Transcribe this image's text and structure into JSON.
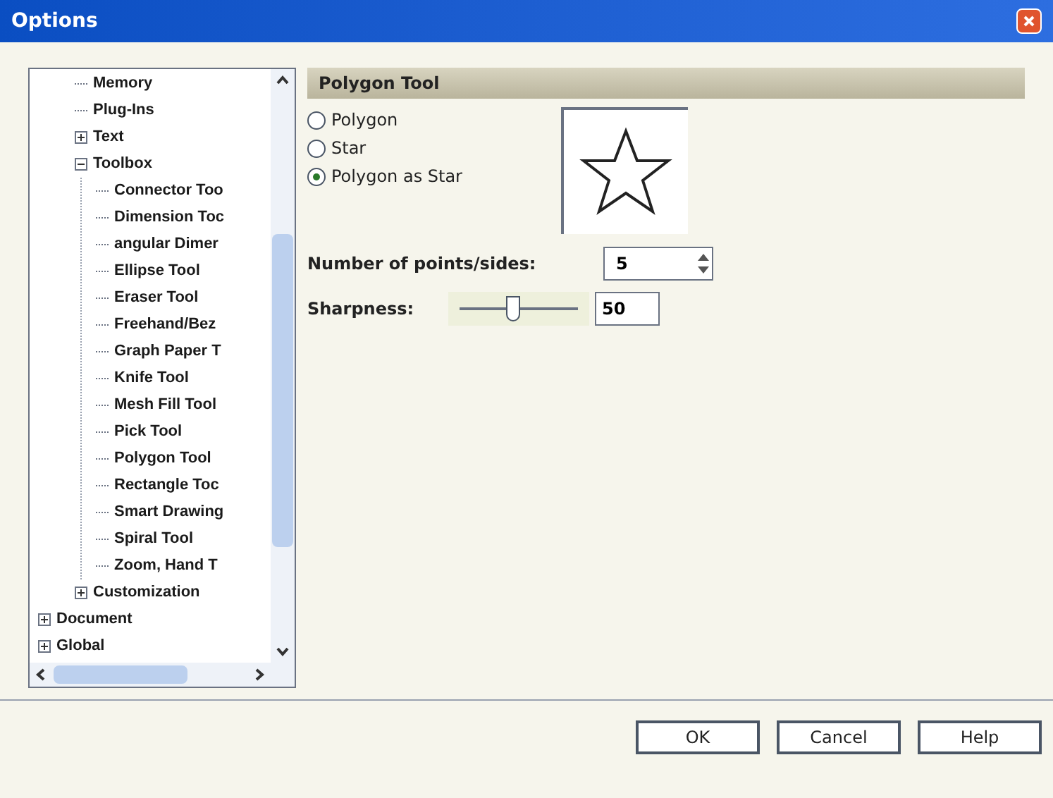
{
  "window": {
    "title": "Options"
  },
  "tree": [
    {
      "children": [
        {
          "label": "Memory"
        },
        {
          "label": "Plug-Ins"
        },
        {
          "label": "Text",
          "expanded": false
        },
        {
          "label": "Toolbox",
          "expanded": true,
          "children": [
            {
              "label": "Connector Too"
            },
            {
              "label": "Dimension Toc"
            },
            {
              "label": "angular Dimer"
            },
            {
              "label": "Ellipse Tool"
            },
            {
              "label": "Eraser Tool"
            },
            {
              "label": "Freehand/Bez"
            },
            {
              "label": "Graph Paper T"
            },
            {
              "label": "Knife Tool"
            },
            {
              "label": "Mesh Fill Tool"
            },
            {
              "label": "Pick Tool"
            },
            {
              "label": "Polygon Tool"
            },
            {
              "label": "Rectangle Toc"
            },
            {
              "label": "Smart Drawing"
            },
            {
              "label": "Spiral Tool"
            },
            {
              "label": "Zoom, Hand T"
            }
          ]
        },
        {
          "label": "Customization",
          "expanded": false
        }
      ]
    },
    {
      "label": "Document",
      "expanded": false
    },
    {
      "label": "Global",
      "expanded": false
    }
  ],
  "panel": {
    "title": "Polygon Tool",
    "modes": [
      {
        "label": "Polygon",
        "selected": false
      },
      {
        "label": "Star",
        "selected": false
      },
      {
        "label": "Polygon as Star",
        "selected": true
      }
    ],
    "points": {
      "label": "Number of points/sides:",
      "value": "5"
    },
    "sharpness": {
      "label": "Sharpness:",
      "level": 0.45,
      "value": "50"
    }
  },
  "buttons": [
    "OK",
    "Cancel",
    "Help"
  ]
}
